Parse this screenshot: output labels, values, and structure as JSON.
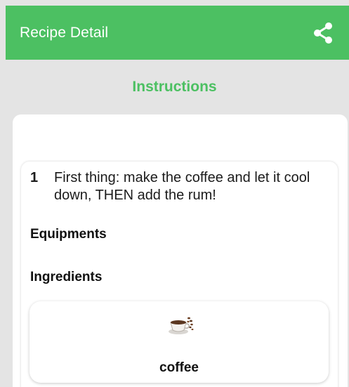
{
  "appbar": {
    "title": "Recipe Detail",
    "share_icon": "share-icon",
    "bg_color": "#4cc062"
  },
  "section": {
    "title": "Instructions",
    "accent_color": "#4cc062"
  },
  "steps": [
    {
      "number": "1",
      "text": "First thing: make the coffee and let it cool down, THEN add the rum!",
      "equipments_label": "Equipments",
      "ingredients_label": "Ingredients",
      "ingredients": [
        {
          "name": "coffee",
          "icon": "coffee-cup-icon"
        }
      ]
    }
  ]
}
